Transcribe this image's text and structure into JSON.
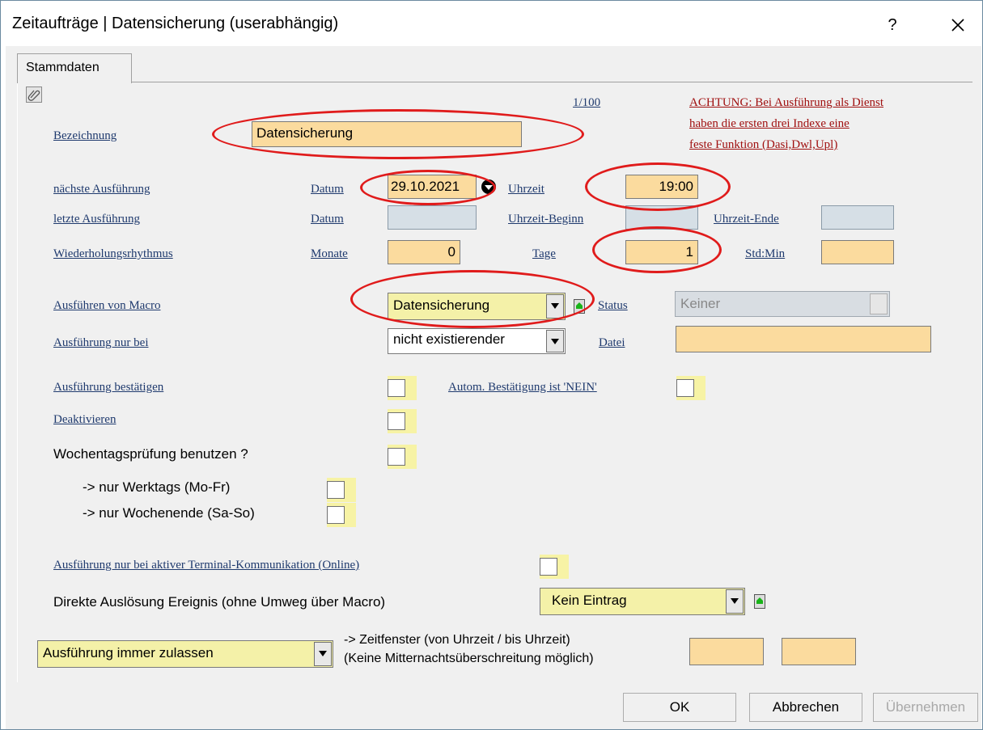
{
  "window": {
    "title": "Zeitaufträge | Datensicherung (userabhängig)",
    "help": "?"
  },
  "tab": {
    "label": "Stammdaten"
  },
  "record_counter": "1/100",
  "warning": {
    "line1": "ACHTUNG: Bei Ausführung als Dienst",
    "line2": "haben die ersten drei Indexe eine",
    "line3": "feste Funktion (Dasi,Dwl,Upl)"
  },
  "labels": {
    "bezeichnung": "Bezeichnung",
    "naechste": "nächste Ausführung",
    "letzte": "letzte Ausführung",
    "wiederholung": "Wiederholungsrhythmus",
    "macro": "Ausführen von Macro",
    "nur_bei": "Ausführung nur bei",
    "bestaetigen": "Ausführung bestätigen",
    "deaktivieren": "Deaktivieren",
    "wochentag": "Wochentagsprüfung benutzen ?",
    "werktags": "-> nur Werktags (Mo-Fr)",
    "wochenende": "-> nur Wochenende (Sa-So)",
    "terminal": "Ausführung nur bei aktiver Terminal-Kommunikation (Online)",
    "direkt": "Direkte Auslösung Ereignis (ohne Umweg über Macro)",
    "datum1": "Datum",
    "datum2": "Datum",
    "uhrzeit": "Uhrzeit",
    "uhrzeit_beginn": "Uhrzeit-Beginn",
    "uhrzeit_ende": "Uhrzeit-Ende",
    "monate": "Monate",
    "tage": "Tage",
    "stdmin": "Std:Min",
    "status": "Status",
    "datei": "Datei",
    "autom": "Autom. Bestätigung ist 'NEIN'",
    "zeitfenster1": "-> Zeitfenster (von Uhrzeit / bis Uhrzeit)",
    "zeitfenster2": "(Keine Mitternachtsüberschreitung möglich)"
  },
  "values": {
    "bezeichnung": "Datensicherung",
    "datum": "29.10.2021",
    "uhrzeit": "19:00",
    "monate": "0",
    "tage": "1",
    "macro": "Datensicherung",
    "status": "Keiner",
    "nur_bei": "nicht existierender",
    "direkt": "Kein Eintrag",
    "zulassen": "Ausführung immer zulassen"
  },
  "buttons": {
    "ok": "OK",
    "cancel": "Abbrechen",
    "apply": "Übernehmen"
  },
  "colors": {
    "field": "#fbdb9e",
    "combo": "#f4f1a8",
    "link": "#1f3a6e",
    "warning": "#a01010",
    "annotation": "#e01b1b"
  }
}
